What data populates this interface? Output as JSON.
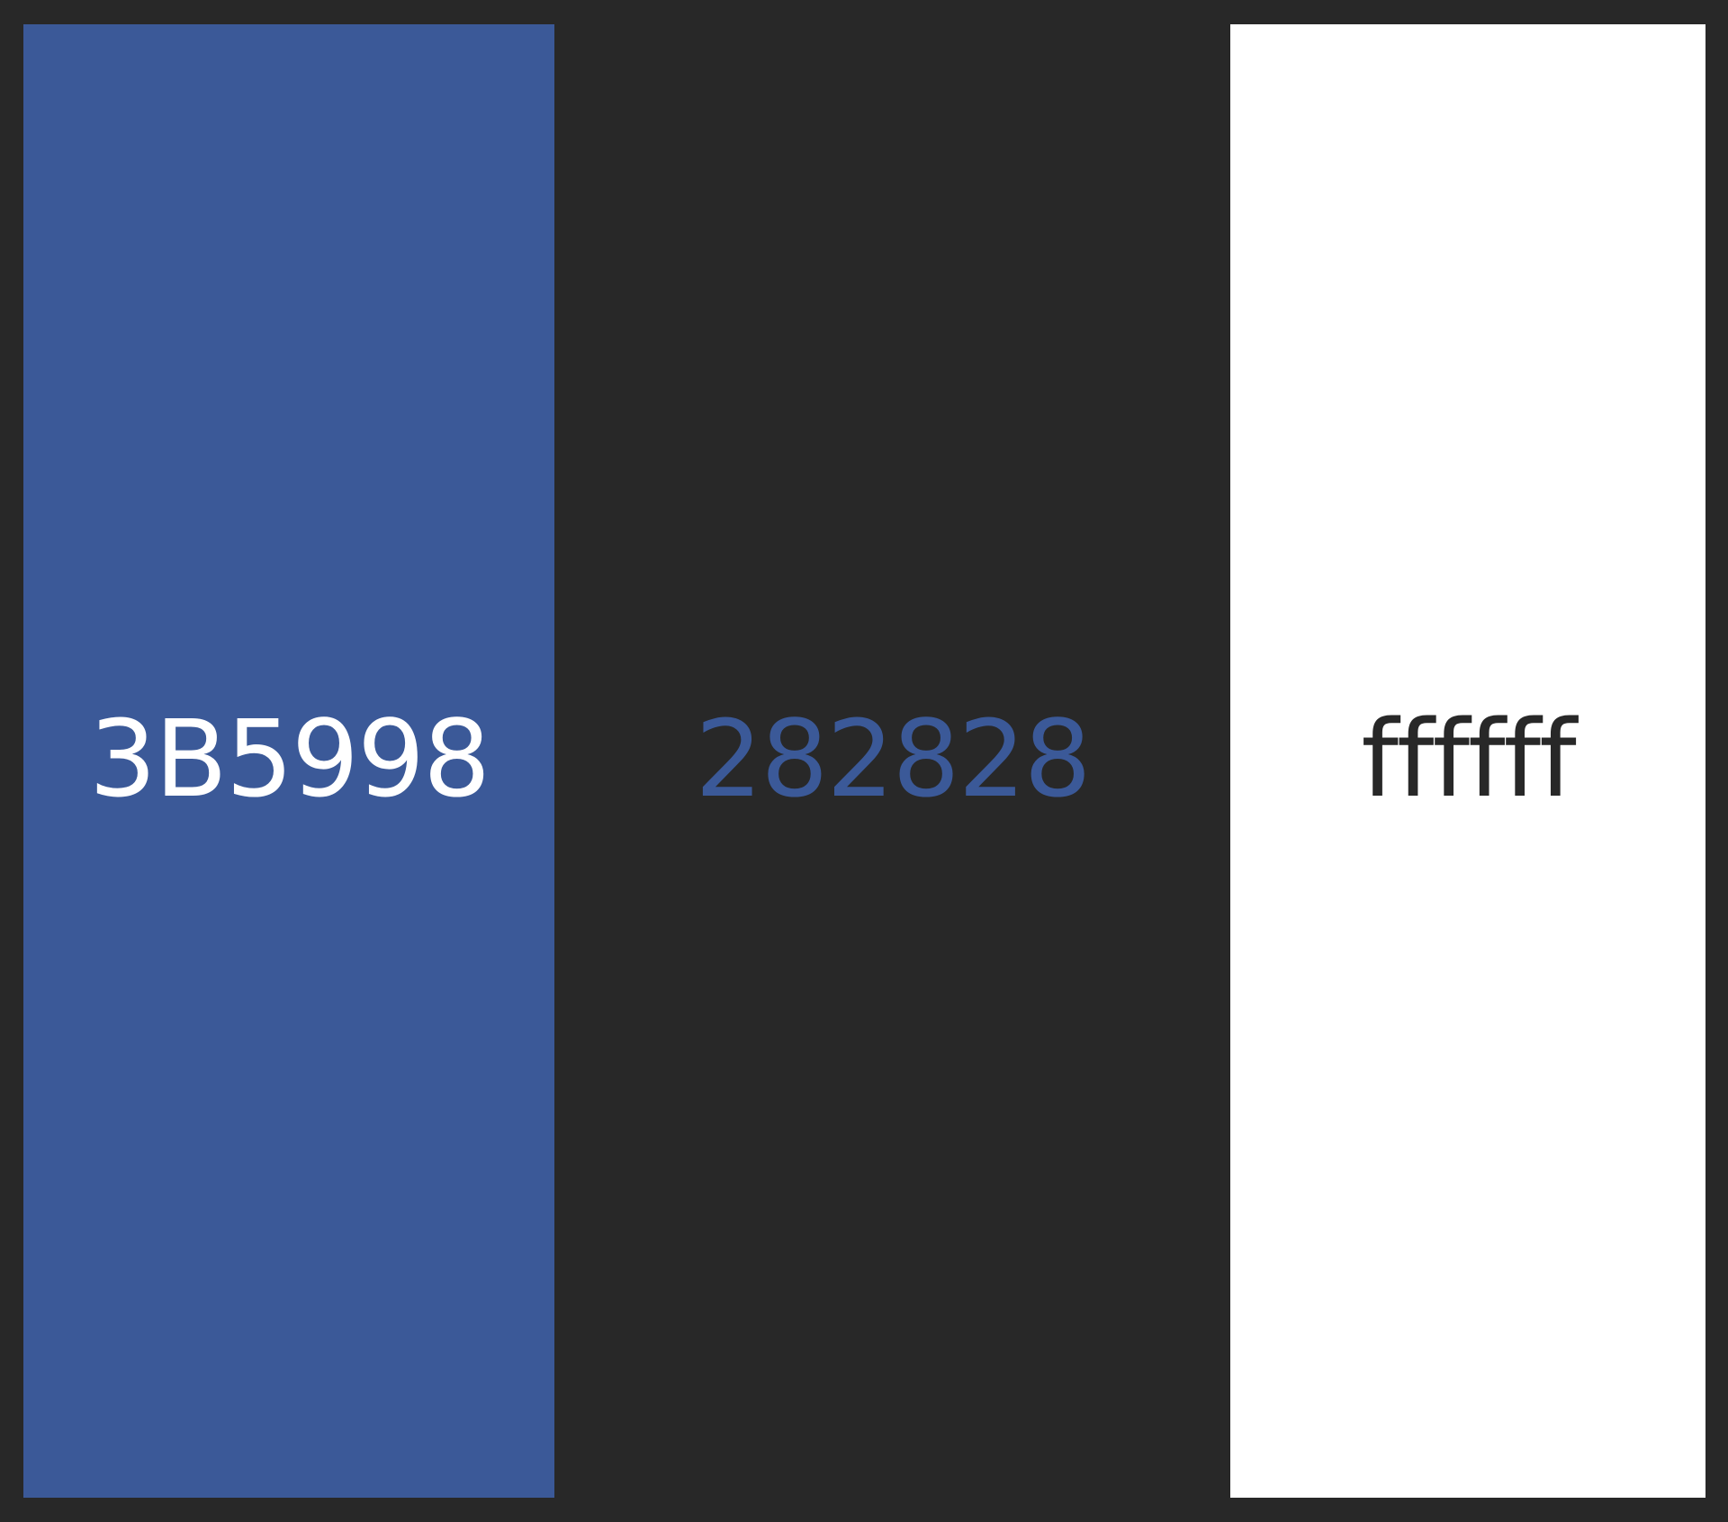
{
  "swatches": [
    {
      "label": "3B5998",
      "background": "#3B5998",
      "text_color": "#ffffff"
    },
    {
      "label": "282828",
      "background": "#282828",
      "text_color": "#3B5998"
    },
    {
      "label": "ffffff",
      "background": "#ffffff",
      "text_color": "#282828"
    }
  ],
  "frame_color": "#282828"
}
